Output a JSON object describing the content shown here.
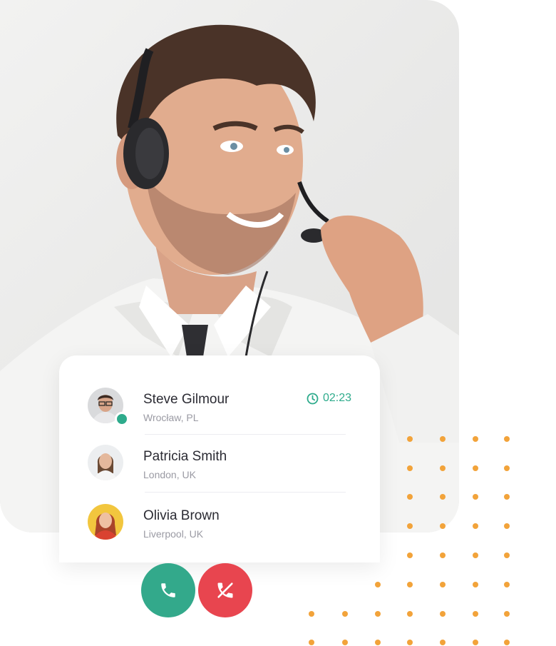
{
  "contacts": [
    {
      "name": "Steve Gilmour",
      "location": "Wrocław, PL",
      "online": true,
      "timer": "02:23"
    },
    {
      "name": "Patricia Smith",
      "location": "London, UK"
    },
    {
      "name": "Olivia Brown",
      "location": "Liverpool, UK"
    }
  ],
  "colors": {
    "accent_green": "#2eab8c",
    "decline_red": "#e8454f",
    "dots_orange": "#f2a33a"
  },
  "icons": {
    "timer": "clock-icon",
    "accept": "phone-icon",
    "decline": "phone-hangup-icon"
  }
}
